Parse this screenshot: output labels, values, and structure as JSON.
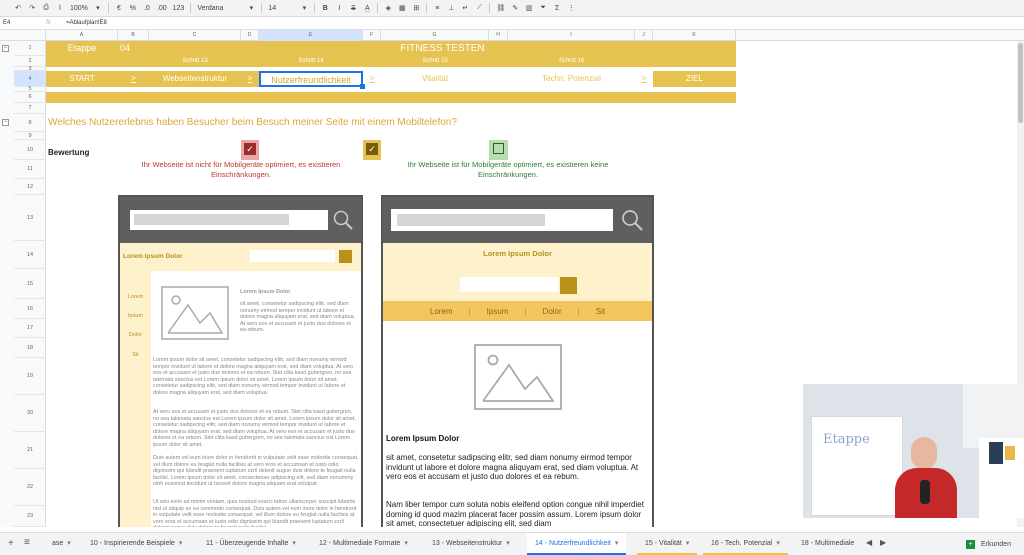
{
  "toolbar": {
    "zoom": "100%",
    "currency": "€",
    "percent": "%",
    "dec_less": ".0",
    "dec_more": ".00",
    "num_format": "123",
    "font": "Verdana",
    "font_size": "14",
    "bold": "B",
    "italic": "I",
    "strike": "S",
    "text_color": "A"
  },
  "formula_bar": {
    "cell_ref": "E4",
    "fx": "fx",
    "value": "=Ablaufplan!E8"
  },
  "columns": [
    "A",
    "B",
    "C",
    "D",
    "E",
    "F",
    "G",
    "H",
    "I",
    "J",
    "K"
  ],
  "rows": [
    "1",
    "2",
    "3",
    "4",
    "5",
    "6",
    "7",
    "8",
    "9",
    "10",
    "11",
    "12",
    "13",
    "14",
    "15",
    "16",
    "17",
    "18",
    "19",
    "20",
    "21",
    "22",
    "23"
  ],
  "header": {
    "etappe_label": "Etappe",
    "etappe_num": "04",
    "title": "FITNESS TESTEN",
    "step13": "Schritt 13",
    "step14": "Schritt 14",
    "step15": "Schritt 15",
    "step16": "Schritt 16"
  },
  "journey": {
    "start": "START",
    "arrow": ">",
    "s13": "Webseitenstruktur",
    "s14": "Nutzerfreundlichkeit",
    "s15": "Vitalität",
    "s16": "Techn. Potenzial",
    "ziel": "ZIEL"
  },
  "question": "Welches Nutzererlebnis haben Besucher beim Besuch meiner Seite mit einem Mobiltelefon?",
  "bewertung": {
    "label": "Bewertung",
    "bad_text": "Ihr Webseite ist nicht für Mobilgeräte optimiert, es existieren Einschränkungen.",
    "good_text": "Ihr Webseite ist für Mobilgeräte optimiert, es existieren keine Einschränkungen.",
    "bad_color": "#c0392b",
    "good_color": "#2e7d32"
  },
  "phone_bad": {
    "heading": "Lorem Ipsum Dolor",
    "nav": [
      "Lorem",
      "Ipsum",
      "Dolor",
      "Sit"
    ],
    "sub": "Lorem Ipsum Dolor",
    "text1": "sit amet, consetetur sadipscing elitr, sed diam nonumy eirmod tempor invidunt ut labore et dolore magna aliquyam erat, sed diam voluptua. At vero eos et accusam et justo duo dolores et ea rebum.",
    "text2": "Lorem ipsum dolor sit amet, consetetur sadipscing elitr, sed diam nonumy eirmod tempor invidunt ut labore et dolore magna aliquyam erat, sed diam voluptua. At vero eos et accusam et justo duo dolores et ea rebum. Stet clita kasd gubergren, no sea takimata sanctus est Lorem ipsum dolor sit amet. Lorem ipsum dolor sit amet, consetetur sadipscing elitr, sed diam nonumy eirmod tempor invidunt ut labore et dolore magna aliquyam erat, sed diam voluptua.",
    "text3": "At vero eos et accusam et justo duo dolores et ea rebum. Stet clita kasd gubergren, no sea takimata sanctus est Lorem ipsum dolor sit amet. Lorem ipsum dolor sit amet, consetetur sadipscing elitr, sed diam nonumy eirmod tempor invidunt ut labore et dolore magna aliquyam erat, sed diam voluptua. At vero eos et accusam et justo duo dolores et ea rebum. Stet clita kasd gubergren, no sea takimata sanctus est Lorem ipsum dolor sit amet.",
    "text4": "Duis autem vel eum iriure dolor in hendrerit in vulputate velit esse molestie consequat, vel illum dolore eu feugiat nulla facilisis at vero eros et accumsan et iusto odio dignissim qui blandit praesent luptatum zzril delenit augue duis dolore te feugait nulla facilisi. Lorem ipsum dolor sit amet, consectetuer adipiscing elit, sed diam nonummy nibh euismod tincidunt ut laoreet dolore magna aliquam erat volutpat.",
    "text5": "Ut wisi enim ad minim veniam, quis nostrud exerci tation ullamcorper suscipit lobortis nisl ut aliquip ex ea commodo consequat. Duis autem vel eum iriure dolor in hendrerit in vulputate velit esse molestie consequat, vel illum dolore eu feugiat nulla facilisis at vero eros et accumsan et iusto odio dignissim qui blandit praesent luptatum zzril delenit augue duis dolore te feugait nulla facilisi."
  },
  "phone_good": {
    "heading": "Lorem Ipsum Dolor",
    "nav": [
      "Lorem",
      "Ipsum",
      "Dolor",
      "Sit"
    ],
    "sep": "|",
    "sub": "Lorem Ipsum Dolor",
    "text1": "sit amet, consetetur sadipscing elitr, sed diam nonumy eirmod tempor invidunt ut labore et dolore magna aliquyam erat, sed diam voluptua. At vero eos et accusam et justo duo dolores et ea rebum.",
    "text2": "Nam liber tempor cum soluta nobis eleifend option congue nihil imperdiet doming id quod mazim placerat facer possim assum. Lorem ipsum dolor sit amet, consectetuer adipiscing elit, sed diam"
  },
  "tabs": [
    "ase",
    "10 - Inspirierende Beispiele",
    "11 - Überzeugende Inhalte",
    "12 - Multimediale Formate",
    "13 - Webseitenstruktur",
    "14 - Nutzerfreundlichkeit",
    "15 - Vitalität",
    "16 - Tech. Potenzial",
    "18 - Multimediale"
  ],
  "explore_label": "Erkunden",
  "video": {
    "whiteboard_text": "Etappe"
  },
  "colors": {
    "gold": "#e6c350",
    "gold_dark": "#b8901b",
    "light_gold": "#fdf2cc",
    "phone_header": "#5f5f5f"
  }
}
